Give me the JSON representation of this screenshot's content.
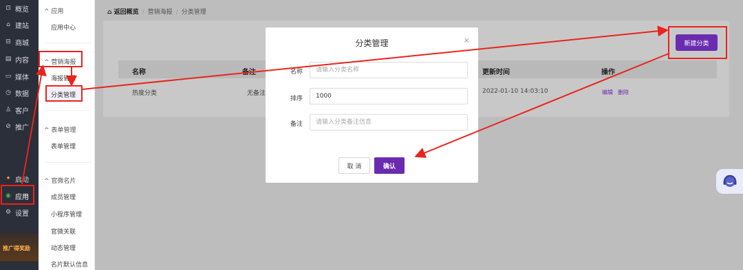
{
  "rail": {
    "items": [
      {
        "icon": "storefront-icon",
        "glyph": "⊡",
        "label": "概览"
      },
      {
        "icon": "home-icon",
        "glyph": "⌂",
        "label": "建站"
      },
      {
        "icon": "shop-icon",
        "glyph": "⊟",
        "label": "商城"
      },
      {
        "icon": "document-icon",
        "glyph": "▤",
        "label": "内容"
      },
      {
        "icon": "media-icon",
        "glyph": "▭",
        "label": "媒体"
      },
      {
        "icon": "clock-icon",
        "glyph": "◷",
        "label": "数据"
      },
      {
        "icon": "user-icon",
        "glyph": "♙",
        "label": "客户"
      },
      {
        "icon": "link-icon",
        "glyph": "⊘",
        "label": "推广"
      }
    ],
    "bottom_items": [
      {
        "icon": "launch-icon",
        "glyph": "✦",
        "label": "启动"
      },
      {
        "icon": "apps-icon",
        "glyph": "◉",
        "label": "应用"
      },
      {
        "icon": "settings-icon",
        "glyph": "⚙",
        "label": "设置"
      }
    ],
    "promo_text": "推广得奖励"
  },
  "sidebar": {
    "groups": [
      {
        "label": "应用",
        "items": [
          "应用中心"
        ]
      },
      {
        "label": "营销海报",
        "items": [
          "海报管理",
          "分类管理"
        ]
      },
      {
        "label": "表单管理",
        "items": [
          "表单管理"
        ]
      },
      {
        "label": "官微名片",
        "items": [
          "成员管理",
          "小程序管理",
          "官微关联",
          "动态管理",
          "名片默认信息"
        ]
      }
    ]
  },
  "breadcrumb": {
    "home": "返回概览",
    "parts": [
      "营销海报",
      "分类管理"
    ]
  },
  "toolbar": {
    "new_button": "新建分类"
  },
  "table": {
    "headers": [
      "名称",
      "备注",
      "更新时间",
      "操作"
    ],
    "row": {
      "name": "热度分类",
      "note": "无备注",
      "updated": "2022-01-10 14:03:10",
      "edit": "编辑",
      "delete": "删除"
    }
  },
  "modal": {
    "title": "分类管理",
    "close": "×",
    "fields": [
      {
        "label": "名称",
        "value": "",
        "placeholder": "请输入分类名称"
      },
      {
        "label": "排序",
        "value": "1000",
        "placeholder": ""
      },
      {
        "label": "备注",
        "value": "",
        "placeholder": "请输入分类备注信息"
      }
    ],
    "cancel": "取 消",
    "confirm": "确认"
  },
  "colors": {
    "accent": "#6a2bb0",
    "annotation": "#e8241c"
  }
}
